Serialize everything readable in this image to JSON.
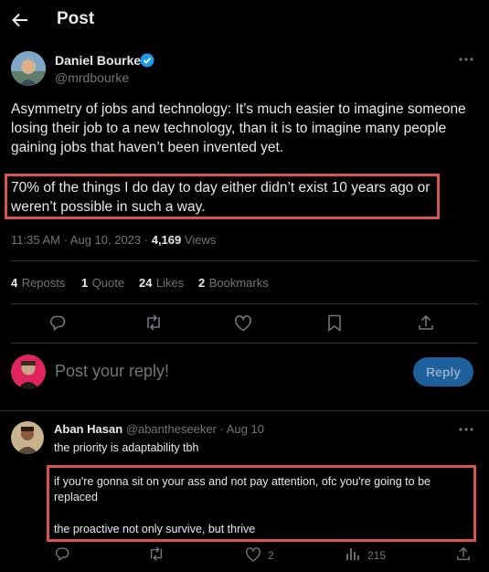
{
  "header": {
    "title": "Post"
  },
  "post": {
    "author_name": "Daniel Bourke",
    "author_handle": "@mrdbourke",
    "paragraph1": "Asymmetry of jobs and technology: It’s much easier to imagine someone losing their job to a new technology, than it is to imagine many people gaining jobs that haven’t been invented yet.",
    "paragraph2": "70% of the things I do day to day either didn’t exist 10 years ago or weren’t possible in such a way.",
    "timestamp": "11:35 AM · Aug 10, 2023 ·",
    "views_count": "4,169",
    "views_label": "Views",
    "stats": {
      "reposts_num": "4",
      "reposts_label": "Reposts",
      "quotes_num": "1",
      "quotes_label": "Quote",
      "likes_num": "24",
      "likes_label": "Likes",
      "bookmarks_num": "2",
      "bookmarks_label": "Bookmarks"
    }
  },
  "composer": {
    "placeholder": "Post your reply!",
    "reply_button": "Reply"
  },
  "reply": {
    "author_name": "Aban Hasan",
    "author_handle": "@abantheseeker · Aug 10",
    "line1": "the priority is adaptability tbh",
    "line2": "if you're gonna sit on your ass and not pay attention, ofc you're going to be replaced",
    "line3": "the proactive not only survive, but thrive",
    "like_count": "2",
    "views_count": "215"
  },
  "colors": {
    "accent": "#1d9bf0",
    "highlight_border": "#d9534f",
    "verified": "#1d9bf0"
  }
}
